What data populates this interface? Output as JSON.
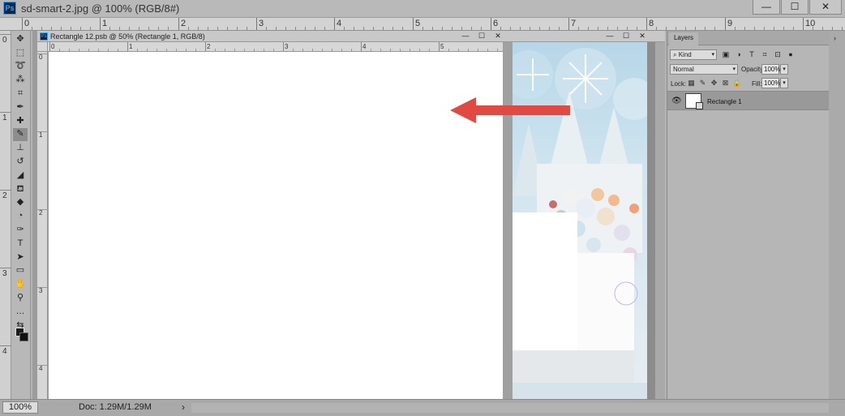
{
  "window": {
    "app_icon": "Ps",
    "title": "sd-smart-2.jpg @ 100% (RGB/8#)",
    "buttons": {
      "minimize": "—",
      "maximize": "☐",
      "close": "✕"
    }
  },
  "main_ruler": {
    "numbers": [
      "0",
      "1",
      "2",
      "3",
      "4",
      "5",
      "6",
      "7",
      "8",
      "9",
      "10"
    ]
  },
  "left_ruler": {
    "numbers": [
      "0",
      "1",
      "2",
      "3",
      "4"
    ]
  },
  "tools": [
    {
      "name": "move-tool-icon",
      "glyph": "✥"
    },
    {
      "name": "marquee-tool-icon",
      "glyph": "⬚"
    },
    {
      "name": "lasso-tool-icon",
      "glyph": "➰"
    },
    {
      "name": "quick-select-tool-icon",
      "glyph": "⁂"
    },
    {
      "name": "crop-tool-icon",
      "glyph": "⌗"
    },
    {
      "name": "eyedropper-tool-icon",
      "glyph": "✒"
    },
    {
      "name": "healing-brush-tool-icon",
      "glyph": "✚"
    },
    {
      "name": "brush-tool-icon",
      "glyph": "✎",
      "active": true
    },
    {
      "name": "clone-stamp-tool-icon",
      "glyph": "⊥"
    },
    {
      "name": "history-brush-tool-icon",
      "glyph": "↺"
    },
    {
      "name": "eraser-tool-icon",
      "glyph": "◢"
    },
    {
      "name": "paint-bucket-tool-icon",
      "glyph": "⛾"
    },
    {
      "name": "blur-tool-icon",
      "glyph": "◆"
    },
    {
      "name": "dodge-tool-icon",
      "glyph": "◔"
    },
    {
      "name": "pen-tool-icon",
      "glyph": "✑"
    },
    {
      "name": "type-tool-icon",
      "glyph": "T"
    },
    {
      "name": "path-select-tool-icon",
      "glyph": "➤"
    },
    {
      "name": "rectangle-tool-icon",
      "glyph": "▭"
    },
    {
      "name": "hand-tool-icon",
      "glyph": "✋"
    },
    {
      "name": "zoom-tool-icon",
      "glyph": "⚲"
    },
    {
      "name": "more-tools-icon",
      "glyph": "…"
    },
    {
      "name": "swap-colors-icon",
      "glyph": "⇆"
    }
  ],
  "doc1": {
    "icon": "Ps",
    "title": "Rectangle 12.psb @ 50% (Rectangle 1, RGB/8)",
    "ruler_numbers": [
      "0",
      "1",
      "2",
      "3",
      "4",
      "5"
    ],
    "vruler_numbers": [
      "0",
      "1",
      "2",
      "3",
      "4"
    ],
    "buttons": {
      "minimize": "—",
      "maximize": "☐",
      "close": "✕"
    }
  },
  "doc2": {
    "buttons": {
      "minimize": "—",
      "maximize": "☐",
      "close": "✕"
    }
  },
  "layers": {
    "tab": "Layers",
    "kind": "Kind",
    "kind_icon": "⌕",
    "blend_mode": "Normal",
    "opacity_label": "Opacity:",
    "opacity": "100%",
    "lock_label": "Lock:",
    "fill_label": "Fill:",
    "fill": "100%",
    "layer_name": "Rectangle 1"
  },
  "status": {
    "zoom": "100%",
    "doc_size": "Doc: 1.29M/1.29M"
  },
  "colors": {
    "arrow": "#e04a43",
    "canvas": "#ffffff",
    "panel": "#b6b6b6"
  }
}
